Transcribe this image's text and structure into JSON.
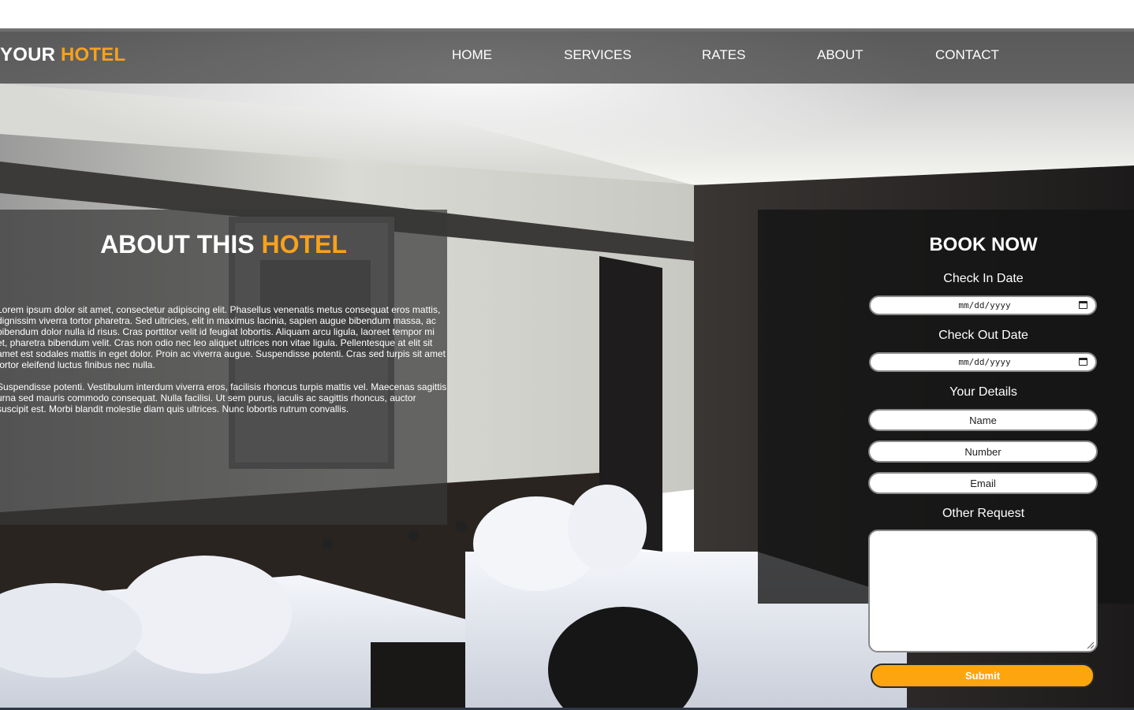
{
  "brand": {
    "prefix": "YOUR",
    "accent": "HOTEL"
  },
  "nav": {
    "home": "HOME",
    "services": "SERVICES",
    "rates": "RATES",
    "about": "ABOUT",
    "contact": "CONTACT"
  },
  "about": {
    "title_prefix": "ABOUT THIS",
    "title_accent": "HOTEL",
    "paragraph1": "Lorem ipsum dolor sit amet, consectetur adipiscing elit. Phasellus venenatis metus consequat eros mattis, dignissim viverra tortor pharetra. Sed ultricies, elit in maximus lacinia, sapien augue bibendum massa, ac bibendum dolor nulla id risus. Cras porttitor velit id feugiat lobortis. Aliquam arcu ligula, laoreet tempor mi et, pharetra bibendum velit. Cras non odio nec leo aliquet ultrices non vitae ligula. Pellentesque at elit sit amet est sodales mattis in eget dolor. Proin ac viverra augue. Suspendisse potenti. Cras sed turpis sit amet tortor eleifend luctus finibus nec nulla.",
    "paragraph2": "Suspendisse potenti. Vestibulum interdum viverra eros, facilisis rhoncus turpis mattis vel. Maecenas sagittis urna sed mauris commodo consequat. Nulla facilisi. Ut sem purus, iaculis ac sagittis rhoncus, auctor suscipit est. Morbi blandit molestie diam quis ultrices. Nunc lobortis rutrum convallis."
  },
  "booking": {
    "title": "BOOK NOW",
    "check_in_label": "Check In Date",
    "check_in_value": "mm/dd/yyyy",
    "check_out_label": "Check Out Date",
    "check_out_value": "mm/dd/yyyy",
    "details_label": "Your Details",
    "name_placeholder": "Name",
    "number_placeholder": "Number",
    "email_placeholder": "Email",
    "request_label": "Other Request",
    "request_value": "",
    "submit_label": "Submit"
  },
  "colors": {
    "accent": "#f7a21b",
    "submit": "#fca50f",
    "navbar": "#2d2d2d"
  },
  "icons": {
    "date": "calendar-icon",
    "textarea": "resize-grip-icon"
  }
}
